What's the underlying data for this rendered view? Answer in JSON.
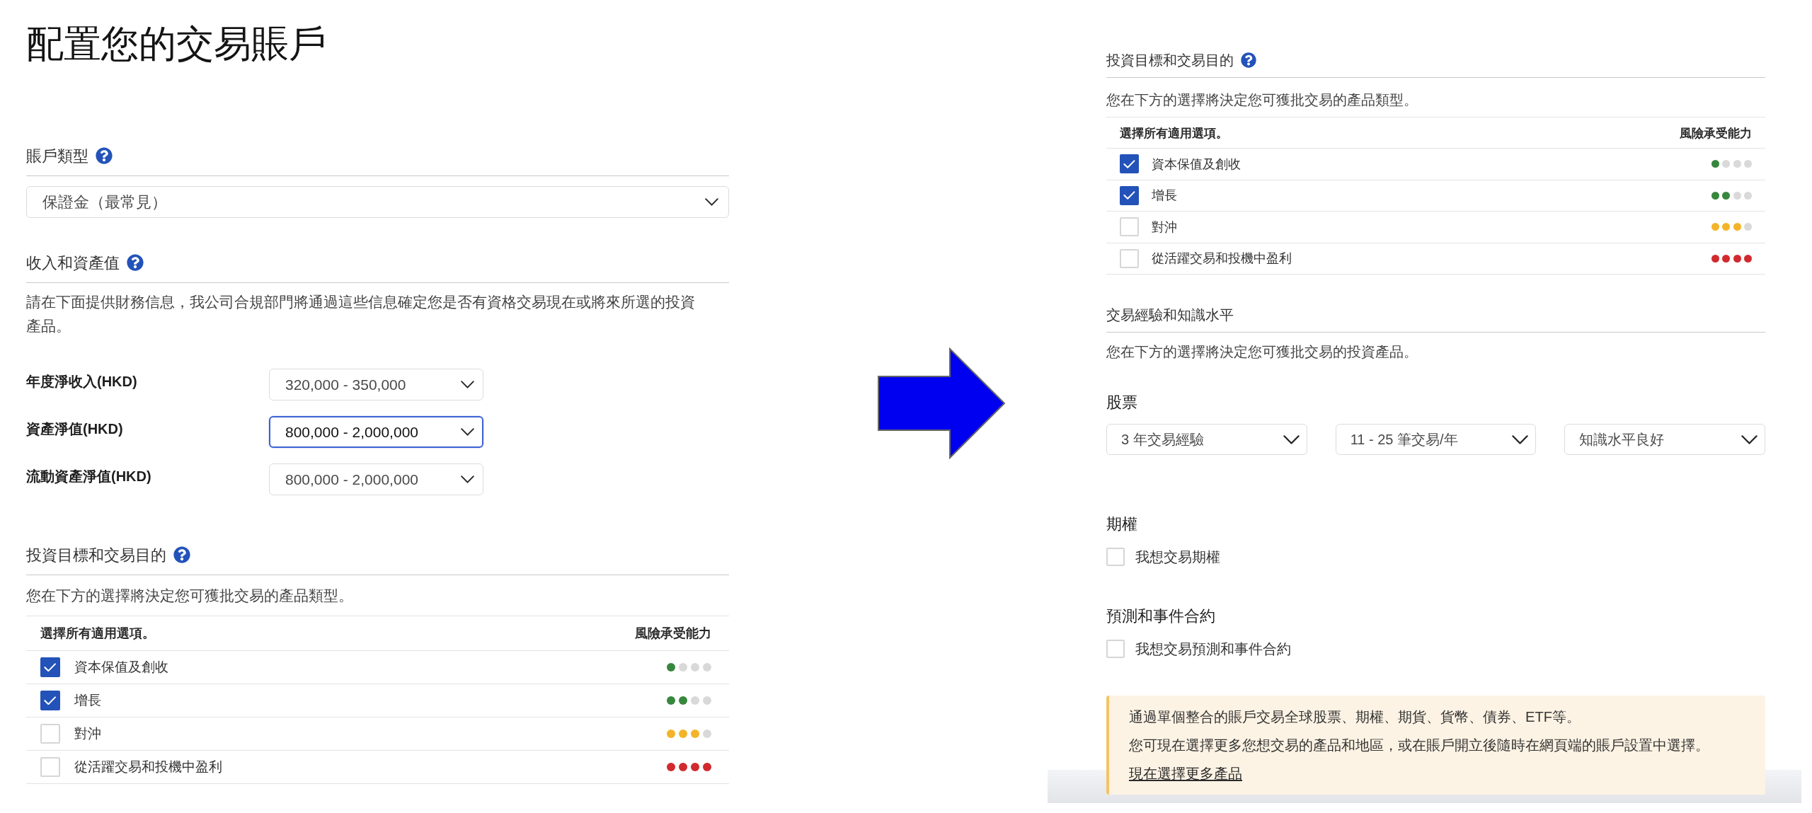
{
  "left": {
    "title": "配置您的交易賬戶",
    "account_type": {
      "heading": "賬戶類型",
      "help": true,
      "select": {
        "value": "保證金（最常見）"
      }
    },
    "income": {
      "heading": "收入和資產值",
      "help": true,
      "description": "請在下面提供財務信息，我公司合規部門將通過這些信息確定您是否有資格交易現在或將來所選的投資產品。",
      "fields": [
        {
          "label": "年度淨收入(HKD)",
          "value": "320,000 - 350,000",
          "focused": false
        },
        {
          "label": "資產淨值(HKD)",
          "value": "800,000 - 2,000,000",
          "focused": true
        },
        {
          "label": "流動資產淨值(HKD)",
          "value": "800,000 - 2,000,000",
          "focused": false
        }
      ]
    },
    "objectives": {
      "heading": "投資目標和交易目的",
      "help": true,
      "description": "您在下方的選擇將決定您可獲批交易的產品類型。",
      "columns": [
        "選擇所有適用選項。",
        "風險承受能力"
      ],
      "rows": [
        {
          "label": "資本保值及創收",
          "checked": true,
          "stars": 1,
          "color": "#37873d"
        },
        {
          "label": "增長",
          "checked": true,
          "stars": 2,
          "color": "#37873d"
        },
        {
          "label": "對沖",
          "checked": false,
          "stars": 3,
          "color": "#f4b429"
        },
        {
          "label": "從活躍交易和投機中盈利",
          "checked": false,
          "stars": 4,
          "color": "#d12a2e"
        }
      ]
    }
  },
  "right": {
    "objectives": {
      "heading": "投資目標和交易目的",
      "help": true,
      "description": "您在下方的選擇將決定您可獲批交易的產品類型。",
      "columns": [
        "選擇所有適用選項。",
        "風險承受能力"
      ],
      "rows": [
        {
          "label": "資本保值及創收",
          "checked": true,
          "stars": 1,
          "color": "#37873d"
        },
        {
          "label": "增長",
          "checked": true,
          "stars": 2,
          "color": "#37873d"
        },
        {
          "label": "對沖",
          "checked": false,
          "stars": 3,
          "color": "#f4b429"
        },
        {
          "label": "從活躍交易和投機中盈利",
          "checked": false,
          "stars": 4,
          "color": "#d12a2e"
        }
      ]
    },
    "experience": {
      "heading": "交易經驗和知識水平",
      "help": false,
      "description": "您在下方的選擇將決定您可獲批交易的投資產品。",
      "products": [
        {
          "kind": "selects",
          "title": "股票",
          "selects": [
            "3 年交易經驗",
            "11 - 25 筆交易/年",
            "知識水平良好"
          ]
        },
        {
          "kind": "checkbox",
          "title": "期權",
          "option": {
            "label": "我想交易期權",
            "checked": false
          }
        },
        {
          "kind": "checkbox",
          "title": "預測和事件合約",
          "option": {
            "label": "我想交易預測和事件合約",
            "checked": false
          }
        }
      ]
    },
    "notice": {
      "lines": [
        "通過單個整合的賬戶交易全球股票、期權、期貨、貨幣、債券、ETF等。",
        "您可現在選擇更多您想交易的產品和地區，或在賬戶開立後隨時在網頁端的賬戶設置中選擇。"
      ],
      "link": "現在選擇更多產品"
    }
  }
}
